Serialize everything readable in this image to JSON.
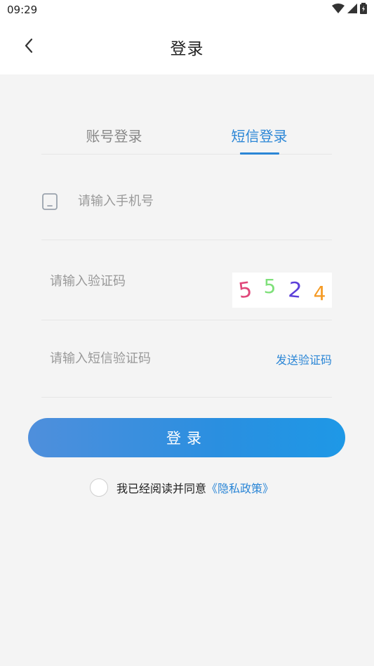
{
  "status_bar": {
    "time": "09:29",
    "icons": [
      "wifi-icon",
      "signal-icon",
      "battery-icon"
    ]
  },
  "header": {
    "title": "登录",
    "back_icon": "chevron-left-icon"
  },
  "tabs": [
    {
      "label": "账号登录",
      "active": false
    },
    {
      "label": "短信登录",
      "active": true
    }
  ],
  "form": {
    "phone": {
      "placeholder": "请输入手机号",
      "value": "",
      "icon": "phone-icon"
    },
    "captcha": {
      "placeholder": "请输入验证码",
      "value": "",
      "image_digits": [
        "5",
        "5",
        "2",
        "4"
      ]
    },
    "sms": {
      "placeholder": "请输入短信验证码",
      "value": "",
      "send_label": "发送验证码"
    }
  },
  "login_button": {
    "label": "登录"
  },
  "agreement": {
    "text": "我已经阅读并同意",
    "link": "《隐私政策》",
    "checked": false
  },
  "colors": {
    "accent": "#2b86d6",
    "button_gradient_start": "#4f8fdc",
    "button_gradient_end": "#1e98e6",
    "background": "#f4f4f4"
  }
}
